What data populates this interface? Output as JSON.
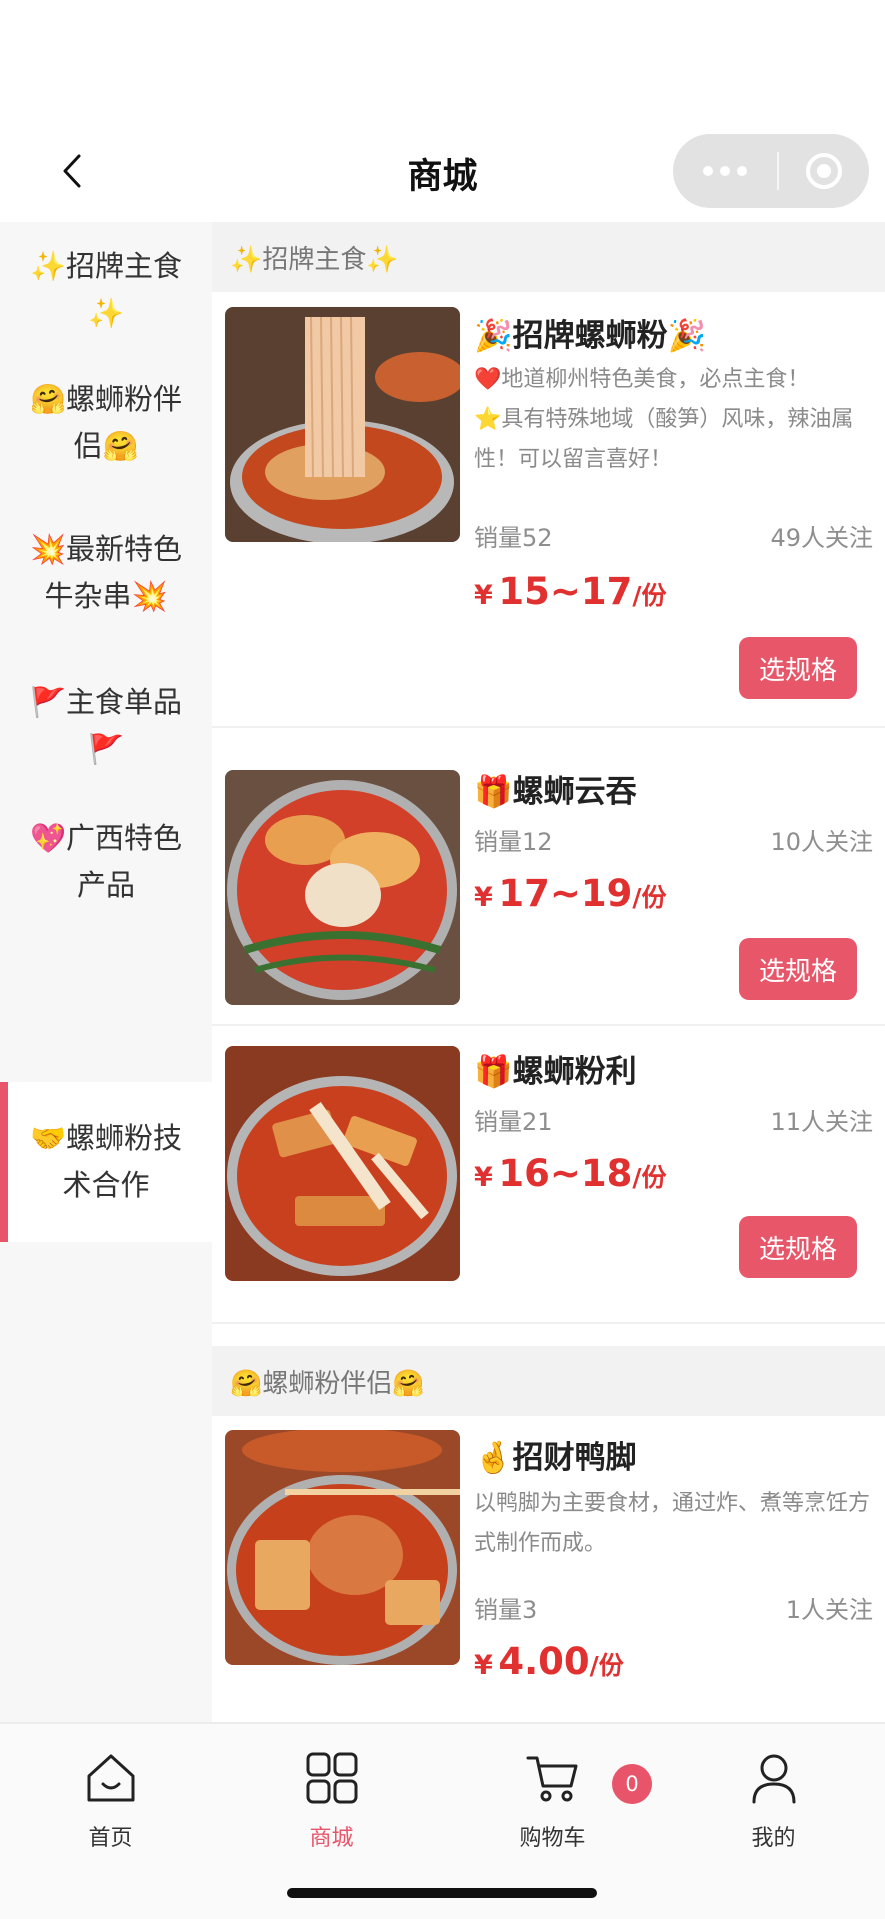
{
  "header": {
    "title": "商城",
    "back_icon": "chevron-left-icon",
    "capsule_icons": [
      "more-dots-icon",
      "target-circle-icon"
    ]
  },
  "sidebar": {
    "items": [
      {
        "label": "✨招牌主食✨",
        "active": false
      },
      {
        "label": "🤗螺蛳粉伴侣🤗",
        "active": false
      },
      {
        "label": "💥最新特色牛杂串💥",
        "active": false
      },
      {
        "label": "🚩主食单品🚩",
        "active": false
      },
      {
        "label": "💖广西特色产品",
        "active": false
      },
      {
        "label": "🤝螺蛳粉技术合作",
        "active": true
      }
    ]
  },
  "sections": [
    {
      "title": "✨招牌主食✨"
    },
    {
      "title": "🤗螺蛳粉伴侣🤗"
    }
  ],
  "products": [
    {
      "name": "🎉招牌螺蛳粉🎉",
      "desc": [
        "❤️地道柳州特色美食，必点主食！",
        "⭐具有特殊地域（酸笋）风味，辣油属性！可以留言喜好！"
      ],
      "sales": "销量52",
      "followers": "49人关注",
      "price_symbol": "¥",
      "price": "15~17",
      "unit": "/份",
      "button": "选规格"
    },
    {
      "name": "🎁螺蛳云吞",
      "sales": "销量12",
      "followers": "10人关注",
      "price_symbol": "¥",
      "price": "17~19",
      "unit": "/份",
      "button": "选规格"
    },
    {
      "name": "🎁螺蛳粉利",
      "sales": "销量21",
      "followers": "11人关注",
      "price_symbol": "¥",
      "price": "16~18",
      "unit": "/份",
      "button": "选规格"
    },
    {
      "name": "🤞招财鸭脚",
      "desc": [
        "以鸭脚为主要食材，通过炸、煮等烹饪方式制作而成。"
      ],
      "sales": "销量3",
      "followers": "1人关注",
      "price_symbol": "¥",
      "price": "4.00",
      "unit": "/份"
    }
  ],
  "tabbar": {
    "items": [
      {
        "label": "首页",
        "icon": "home-icon",
        "active": false
      },
      {
        "label": "商城",
        "icon": "grid-icon",
        "active": true
      },
      {
        "label": "购物车",
        "icon": "cart-icon",
        "active": false,
        "badge": "0"
      },
      {
        "label": "我的",
        "icon": "user-icon",
        "active": false
      }
    ]
  },
  "colors": {
    "accent": "#e8556a",
    "price": "#e03030",
    "sidebar_bg": "#f7f7f7",
    "section_bg": "#f2f2f2"
  }
}
